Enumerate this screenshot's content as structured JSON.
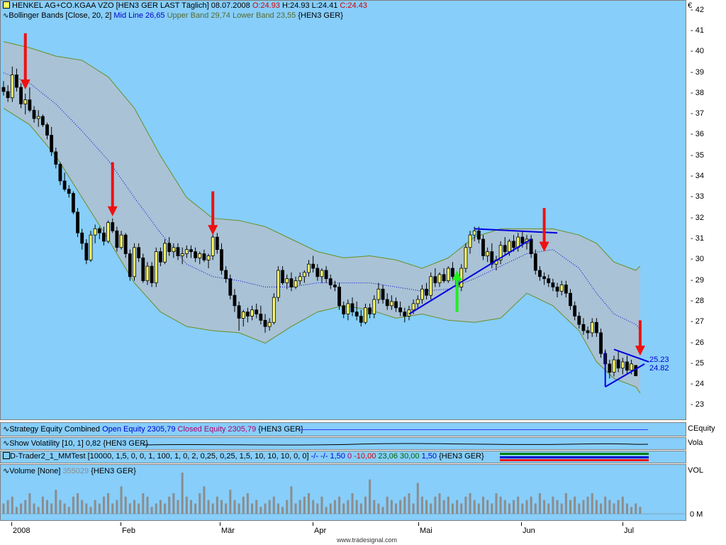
{
  "header": {
    "line1": {
      "name": "HENKEL AG+CO.KGAA VZO [HEN3 GER LAST Täglich] 08.07.2008",
      "o": "O:24.93",
      "h": "H:24.93",
      "l": "L:24.41",
      "c": "C:24.43"
    },
    "line2": {
      "bb": "Bollinger Bands [Close, 20, 2]",
      "mid": "Mid Line 26,65",
      "upper": "Upper Band 29,74",
      "lower": "Lower Band 23,55",
      "sym": "{HEN3 GER}"
    },
    "currency": "€"
  },
  "strategy_panel": {
    "title": "Strategy Equity Combined",
    "open": "Open Equity 2305,79",
    "closed": "Closed Equity 2305,79",
    "sym": "{HEN3 GER}",
    "axis_label": "CEquity"
  },
  "volatility_panel": {
    "title": "Show Volatility [10, 1]",
    "value": "0,82",
    "sym": "{HEN3 GER}",
    "axis_label": "Vola"
  },
  "trader_panel": {
    "title": "D-Trader2_1_MMTest [10000, 1,5, 0, 0, 1, 100, 1, 0, 2, 0,25, 0,25, 1,5, 10, 10, 10, 0, 0]",
    "v1": "-/- -/- 1,50",
    "v2": "0",
    "v3": "-10,00",
    "v4": "23,06",
    "v5": "30,00",
    "v6": "1,50",
    "sym": "{HEN3 GER}"
  },
  "volume_panel": {
    "title": "Volume [None]",
    "value": "355029",
    "sym": "{HEN3 GER}",
    "axis_label": "VOL",
    "zero_label": "0 M"
  },
  "footer": "www.tradesignal.com",
  "colors": {
    "background": "#87cefa",
    "band_fill": "#a9c2d6",
    "band_line": "#6b8e23",
    "mid_line": "#0000cd",
    "up_candle": "#ffff66",
    "down_candle": "#000000",
    "arrow_sell": "#ee1111",
    "arrow_buy": "#22ee22",
    "trendline": "#0000dd",
    "volume_bar": "#8c8c8c"
  },
  "chart_data": {
    "type": "candlestick",
    "ylim": [
      22.3,
      42.5
    ],
    "y_ticks": [
      "23",
      "24",
      "25",
      "26",
      "27",
      "28",
      "29",
      "30",
      "31",
      "32",
      "33",
      "34",
      "35",
      "36",
      "37",
      "38",
      "39",
      "40",
      "41",
      "42"
    ],
    "x_ticks": [
      "2008",
      "Feb",
      "Mär",
      "Apr",
      "Mai",
      "Jun",
      "Jul"
    ],
    "price_labels": [
      "25.23",
      "24.82"
    ],
    "ohlc": [
      [
        38.3,
        38.6,
        37.9,
        38.1
      ],
      [
        38.1,
        38.4,
        37.6,
        37.8
      ],
      [
        37.8,
        39.3,
        37.6,
        38.9
      ],
      [
        38.9,
        39.2,
        38.1,
        38.3
      ],
      [
        38.3,
        38.5,
        37.3,
        37.5
      ],
      [
        37.5,
        38.0,
        37.0,
        37.7
      ],
      [
        37.7,
        38.3,
        37.1,
        37.2
      ],
      [
        37.2,
        37.4,
        36.6,
        36.8
      ],
      [
        36.8,
        37.2,
        36.4,
        36.9
      ],
      [
        36.9,
        37.0,
        36.4,
        36.5
      ],
      [
        36.5,
        36.6,
        35.8,
        36.0
      ],
      [
        36.0,
        36.4,
        35.0,
        35.2
      ],
      [
        35.2,
        35.4,
        34.4,
        34.6
      ],
      [
        34.6,
        34.7,
        33.6,
        33.8
      ],
      [
        33.8,
        34.2,
        33.3,
        33.4
      ],
      [
        33.4,
        33.6,
        33.0,
        33.2
      ],
      [
        33.2,
        33.3,
        32.2,
        32.3
      ],
      [
        32.3,
        32.5,
        31.1,
        31.3
      ],
      [
        31.3,
        31.5,
        30.5,
        30.8
      ],
      [
        30.8,
        31.0,
        29.8,
        30.0
      ],
      [
        30.0,
        31.4,
        29.9,
        31.2
      ],
      [
        31.2,
        31.7,
        30.8,
        31.5
      ],
      [
        31.5,
        31.6,
        31.0,
        31.3
      ],
      [
        31.3,
        31.6,
        30.7,
        30.9
      ],
      [
        30.9,
        31.9,
        30.8,
        31.8
      ],
      [
        31.8,
        32.0,
        31.3,
        31.4
      ],
      [
        31.4,
        31.6,
        30.4,
        30.6
      ],
      [
        30.6,
        31.4,
        30.5,
        31.2
      ],
      [
        31.2,
        31.3,
        30.1,
        30.3
      ],
      [
        30.3,
        30.5,
        29.0,
        29.2
      ],
      [
        29.2,
        30.8,
        29.0,
        30.6
      ],
      [
        30.6,
        30.8,
        29.9,
        30.1
      ],
      [
        30.1,
        30.3,
        28.9,
        29.0
      ],
      [
        29.0,
        29.9,
        28.8,
        29.7
      ],
      [
        29.7,
        29.9,
        28.7,
        28.9
      ],
      [
        28.9,
        30.6,
        28.7,
        30.4
      ],
      [
        30.4,
        30.6,
        29.7,
        29.9
      ],
      [
        29.9,
        31.0,
        29.8,
        30.8
      ],
      [
        30.8,
        31.1,
        30.2,
        30.4
      ],
      [
        30.4,
        30.8,
        30.1,
        30.6
      ],
      [
        30.6,
        30.8,
        30.0,
        30.2
      ],
      [
        30.2,
        30.6,
        29.8,
        30.3
      ],
      [
        30.3,
        30.7,
        30.1,
        30.5
      ],
      [
        30.5,
        30.7,
        30.1,
        30.4
      ],
      [
        30.4,
        30.6,
        29.9,
        30.1
      ],
      [
        30.1,
        30.4,
        29.8,
        30.3
      ],
      [
        30.3,
        30.5,
        29.9,
        30.0
      ],
      [
        30.0,
        30.3,
        29.6,
        30.2
      ],
      [
        30.2,
        31.3,
        30.0,
        31.1
      ],
      [
        31.1,
        31.3,
        30.3,
        30.5
      ],
      [
        30.5,
        30.8,
        29.3,
        29.5
      ],
      [
        29.5,
        29.7,
        28.9,
        29.1
      ],
      [
        29.1,
        29.3,
        28.1,
        28.3
      ],
      [
        28.3,
        28.6,
        27.5,
        27.8
      ],
      [
        27.8,
        28.0,
        26.6,
        27.2
      ],
      [
        27.2,
        27.6,
        26.8,
        27.5
      ],
      [
        27.5,
        27.7,
        27.0,
        27.3
      ],
      [
        27.3,
        27.8,
        27.1,
        27.6
      ],
      [
        27.6,
        27.9,
        27.2,
        27.4
      ],
      [
        27.4,
        27.8,
        26.9,
        27.1
      ],
      [
        27.1,
        27.4,
        26.5,
        26.8
      ],
      [
        26.8,
        27.2,
        26.6,
        27.0
      ],
      [
        27.0,
        28.4,
        26.9,
        28.2
      ],
      [
        28.2,
        29.7,
        28.0,
        29.5
      ],
      [
        29.5,
        29.7,
        28.8,
        28.9
      ],
      [
        28.9,
        29.3,
        28.6,
        29.1
      ],
      [
        29.1,
        29.4,
        28.5,
        28.7
      ],
      [
        28.7,
        29.2,
        28.6,
        29.0
      ],
      [
        29.0,
        29.4,
        28.8,
        29.2
      ],
      [
        29.2,
        29.5,
        28.9,
        29.4
      ],
      [
        29.4,
        30.0,
        29.2,
        29.8
      ],
      [
        29.8,
        30.2,
        29.4,
        29.6
      ],
      [
        29.6,
        29.8,
        29.0,
        29.2
      ],
      [
        29.2,
        29.6,
        28.9,
        29.5
      ],
      [
        29.5,
        29.7,
        28.9,
        29.1
      ],
      [
        29.1,
        29.3,
        28.6,
        28.8
      ],
      [
        28.8,
        29.0,
        28.5,
        28.7
      ],
      [
        28.7,
        28.9,
        27.6,
        27.8
      ],
      [
        27.8,
        28.0,
        27.2,
        27.4
      ],
      [
        27.4,
        28.1,
        27.1,
        27.9
      ],
      [
        27.9,
        28.2,
        27.3,
        27.5
      ],
      [
        27.5,
        28.0,
        27.1,
        27.3
      ],
      [
        27.3,
        27.6,
        26.8,
        27.0
      ],
      [
        27.0,
        27.9,
        26.9,
        27.7
      ],
      [
        27.7,
        27.9,
        27.2,
        27.4
      ],
      [
        27.4,
        28.3,
        27.2,
        28.1
      ],
      [
        28.1,
        28.9,
        27.9,
        28.6
      ],
      [
        28.6,
        28.8,
        27.9,
        28.1
      ],
      [
        28.1,
        28.4,
        27.6,
        27.8
      ],
      [
        27.8,
        28.3,
        27.6,
        28.0
      ],
      [
        28.0,
        28.2,
        27.5,
        27.7
      ],
      [
        27.7,
        28.0,
        27.3,
        27.5
      ],
      [
        27.5,
        27.7,
        27.0,
        27.3
      ],
      [
        27.3,
        27.8,
        27.1,
        27.6
      ],
      [
        27.6,
        28.1,
        27.4,
        27.9
      ],
      [
        27.9,
        28.3,
        27.7,
        28.1
      ],
      [
        28.1,
        28.8,
        27.9,
        28.6
      ],
      [
        28.6,
        28.9,
        28.1,
        28.3
      ],
      [
        28.3,
        29.4,
        28.1,
        29.2
      ],
      [
        29.2,
        29.6,
        28.7,
        28.9
      ],
      [
        28.9,
        29.4,
        28.7,
        29.3
      ],
      [
        29.3,
        29.6,
        28.9,
        29.0
      ],
      [
        29.0,
        29.7,
        28.9,
        29.6
      ],
      [
        29.6,
        29.9,
        29.0,
        29.2
      ],
      [
        29.2,
        29.4,
        28.5,
        28.7
      ],
      [
        28.7,
        29.8,
        28.5,
        29.6
      ],
      [
        29.6,
        30.8,
        29.4,
        30.6
      ],
      [
        30.6,
        31.4,
        30.3,
        31.2
      ],
      [
        31.2,
        31.6,
        30.9,
        31.4
      ],
      [
        31.4,
        31.6,
        30.8,
        31.0
      ],
      [
        31.0,
        31.2,
        30.0,
        30.2
      ],
      [
        30.2,
        30.6,
        29.9,
        30.4
      ],
      [
        30.4,
        30.8,
        29.6,
        29.8
      ],
      [
        29.8,
        30.2,
        29.5,
        30.0
      ],
      [
        30.0,
        30.9,
        29.8,
        30.7
      ],
      [
        30.7,
        31.1,
        30.2,
        30.4
      ],
      [
        30.4,
        31.0,
        30.2,
        30.9
      ],
      [
        30.9,
        31.2,
        30.4,
        30.6
      ],
      [
        30.6,
        31.3,
        30.4,
        31.1
      ],
      [
        31.1,
        31.4,
        30.6,
        30.8
      ],
      [
        30.8,
        31.2,
        30.5,
        31.0
      ],
      [
        31.0,
        31.2,
        30.1,
        30.3
      ],
      [
        30.3,
        30.5,
        29.3,
        29.5
      ],
      [
        29.5,
        29.7,
        29.0,
        29.2
      ],
      [
        29.2,
        29.4,
        28.8,
        29.1
      ],
      [
        29.1,
        29.3,
        28.7,
        28.9
      ],
      [
        28.9,
        29.1,
        28.5,
        28.7
      ],
      [
        28.7,
        28.9,
        28.2,
        28.5
      ],
      [
        28.5,
        29.0,
        28.3,
        28.8
      ],
      [
        28.8,
        29.0,
        28.2,
        28.4
      ],
      [
        28.4,
        28.6,
        27.6,
        27.8
      ],
      [
        27.8,
        28.0,
        27.1,
        27.3
      ],
      [
        27.3,
        27.5,
        26.7,
        26.9
      ],
      [
        26.9,
        27.2,
        26.4,
        26.6
      ],
      [
        26.6,
        26.8,
        26.2,
        26.5
      ],
      [
        26.5,
        27.2,
        26.3,
        27.0
      ],
      [
        27.0,
        27.2,
        26.3,
        26.5
      ],
      [
        26.5,
        26.7,
        25.3,
        25.5
      ],
      [
        25.5,
        25.7,
        24.8,
        25.0
      ],
      [
        25.0,
        25.2,
        24.3,
        24.6
      ],
      [
        24.6,
        25.4,
        24.4,
        25.2
      ],
      [
        25.2,
        25.6,
        24.6,
        24.8
      ],
      [
        24.8,
        25.3,
        24.5,
        25.1
      ],
      [
        25.1,
        25.4,
        24.5,
        24.7
      ],
      [
        24.7,
        25.2,
        24.5,
        25.0
      ],
      [
        24.93,
        24.93,
        24.41,
        24.43
      ]
    ],
    "upper_band": [
      [
        0,
        40.5
      ],
      [
        6,
        40.2
      ],
      [
        12,
        39.8
      ],
      [
        18,
        39.6
      ],
      [
        24,
        38.8
      ],
      [
        30,
        37.3
      ],
      [
        36,
        35.0
      ],
      [
        42,
        33.0
      ],
      [
        48,
        32.0
      ],
      [
        54,
        31.9
      ],
      [
        60,
        31.6
      ],
      [
        66,
        31.0
      ],
      [
        72,
        30.4
      ],
      [
        78,
        30.1
      ],
      [
        84,
        30.2
      ],
      [
        90,
        30.0
      ],
      [
        96,
        29.6
      ],
      [
        102,
        30.1
      ],
      [
        108,
        31.1
      ],
      [
        114,
        31.5
      ],
      [
        120,
        31.5
      ],
      [
        126,
        31.5
      ],
      [
        132,
        31.2
      ],
      [
        136,
        30.8
      ],
      [
        140,
        29.9
      ],
      [
        145,
        29.5
      ],
      [
        146,
        29.7
      ]
    ],
    "lower_band": [
      [
        0,
        37.3
      ],
      [
        6,
        36.5
      ],
      [
        12,
        35.0
      ],
      [
        18,
        33.0
      ],
      [
        24,
        31.0
      ],
      [
        30,
        28.9
      ],
      [
        36,
        27.5
      ],
      [
        42,
        26.8
      ],
      [
        48,
        26.6
      ],
      [
        54,
        26.5
      ],
      [
        60,
        26.0
      ],
      [
        66,
        26.8
      ],
      [
        72,
        27.5
      ],
      [
        78,
        27.8
      ],
      [
        84,
        27.6
      ],
      [
        90,
        27.2
      ],
      [
        96,
        27.4
      ],
      [
        102,
        27.1
      ],
      [
        108,
        27.0
      ],
      [
        114,
        27.2
      ],
      [
        120,
        28.4
      ],
      [
        126,
        27.8
      ],
      [
        132,
        26.6
      ],
      [
        136,
        25.1
      ],
      [
        140,
        24.3
      ],
      [
        145,
        23.9
      ],
      [
        146,
        23.6
      ]
    ],
    "mid_line": [
      [
        0,
        39.0
      ],
      [
        6,
        38.5
      ],
      [
        12,
        37.5
      ],
      [
        18,
        36.2
      ],
      [
        24,
        34.8
      ],
      [
        30,
        33.0
      ],
      [
        36,
        31.3
      ],
      [
        42,
        29.8
      ],
      [
        48,
        29.2
      ],
      [
        54,
        29.0
      ],
      [
        60,
        28.7
      ],
      [
        66,
        28.7
      ],
      [
        72,
        28.9
      ],
      [
        78,
        28.9
      ],
      [
        84,
        28.9
      ],
      [
        90,
        28.7
      ],
      [
        96,
        28.5
      ],
      [
        102,
        28.6
      ],
      [
        108,
        29.1
      ],
      [
        114,
        29.7
      ],
      [
        120,
        30.3
      ],
      [
        126,
        30.5
      ],
      [
        132,
        29.6
      ],
      [
        136,
        28.4
      ],
      [
        140,
        27.4
      ],
      [
        145,
        26.9
      ],
      [
        146,
        26.65
      ]
    ],
    "sell_arrows": [
      [
        5,
        40.9,
        38.2
      ],
      [
        25,
        34.7,
        32.1
      ],
      [
        48,
        33.3,
        31.2
      ],
      [
        124,
        32.5,
        30.4
      ],
      [
        146,
        27.1,
        25.4
      ]
    ],
    "buy_arrows": [
      [
        104,
        27.5,
        29.5
      ]
    ],
    "trendlines": [
      [
        93,
        27.4,
        121,
        31.0
      ],
      [
        108,
        31.5,
        127,
        31.3
      ],
      [
        138,
        23.9,
        147,
        25.0
      ],
      [
        140,
        25.7,
        148,
        25.1
      ],
      [
        138,
        23.9,
        138,
        25.6
      ]
    ],
    "volume": [
      3,
      4,
      5,
      2,
      3,
      4,
      6,
      3,
      2,
      5,
      4,
      3,
      7,
      4,
      3,
      2,
      5,
      6,
      4,
      3,
      2,
      4,
      3,
      5,
      6,
      3,
      4,
      8,
      5,
      3,
      4,
      3,
      6,
      5,
      2,
      3,
      4,
      3,
      5,
      6,
      4,
      12,
      5,
      4,
      3,
      6,
      8,
      4,
      3,
      5,
      4,
      3,
      7,
      4,
      3,
      5,
      6,
      3,
      4,
      2,
      3,
      4,
      5,
      3,
      2,
      4,
      8,
      3,
      4,
      5,
      6,
      4,
      3,
      5,
      2,
      3,
      4,
      5,
      3,
      4,
      6,
      4,
      3,
      5,
      10,
      4,
      3,
      2,
      5,
      4,
      3,
      4,
      5,
      6,
      3,
      9,
      5,
      4,
      3,
      5,
      6,
      4,
      5,
      3,
      4,
      3,
      5,
      6,
      4,
      3,
      5,
      4,
      3,
      6,
      5,
      4,
      3,
      4,
      5,
      3,
      4,
      5,
      3,
      6,
      4,
      3,
      5,
      4,
      3,
      6,
      4,
      5,
      3,
      4,
      5,
      6,
      4,
      3,
      5,
      4,
      3,
      4,
      5,
      3,
      2,
      3,
      2
    ]
  }
}
